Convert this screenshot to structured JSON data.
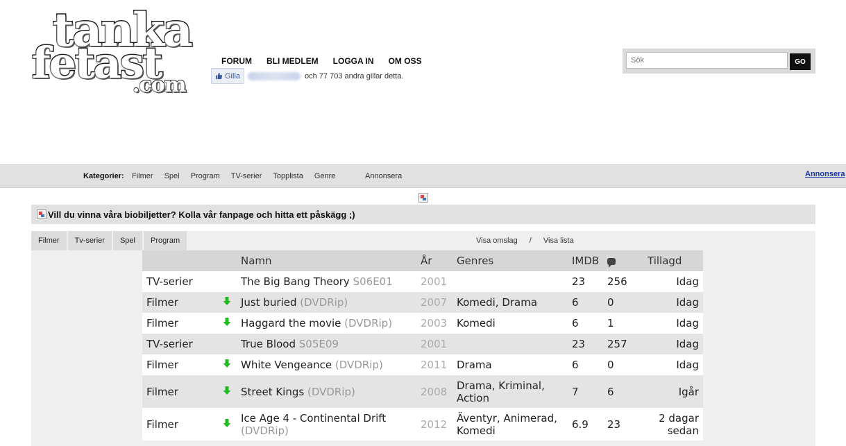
{
  "logo": {
    "line1": "tanka",
    "line2": "fetast",
    "line3": ".com"
  },
  "topnav": [
    "FORUM",
    "BLI MEDLEM",
    "LOGGA IN",
    "OM OSS"
  ],
  "like": {
    "button": "Gilla",
    "text": "och 77 703 andra gillar detta."
  },
  "search": {
    "placeholder": "Sök",
    "button": "GO"
  },
  "catbar": {
    "label": "Kategorier:",
    "items": [
      "Filmer",
      "Spel",
      "Program",
      "TV-serier",
      "Topplista",
      "Genre"
    ],
    "annonsera": "Annonsera",
    "annonsera_link": "Annonsera"
  },
  "banner": {
    "text": "Vill du vinna våra biobiljetter? Kolla vår fanpage och hitta ett påskägg ;)"
  },
  "tabs": [
    "Filmer",
    "Tv-serier",
    "Spel",
    "Program"
  ],
  "views": {
    "cover": "Visa omslag",
    "sep": "/",
    "list": "Visa lista"
  },
  "table": {
    "headers": {
      "name": "Namn",
      "year": "År",
      "genres": "Genres",
      "imdb": "IMDB",
      "added": "Tillagd"
    },
    "rows": [
      {
        "cat": "TV-serier",
        "dl": false,
        "name": "The Big Bang Theory",
        "tag": "S06E01",
        "year": "2001",
        "genres": "",
        "imdb": "23",
        "comments": "256",
        "added": "Idag"
      },
      {
        "cat": "Filmer",
        "dl": true,
        "name": "Just buried",
        "tag": "(DVDRip)",
        "year": "2007",
        "genres": "Komedi, Drama",
        "imdb": "6",
        "comments": "0",
        "added": "Idag"
      },
      {
        "cat": "Filmer",
        "dl": true,
        "name": "Haggard the movie",
        "tag": "(DVDRip)",
        "year": "2003",
        "genres": "Komedi",
        "imdb": "6",
        "comments": "1",
        "added": "Idag"
      },
      {
        "cat": "TV-serier",
        "dl": false,
        "name": "True Blood",
        "tag": "S05E09",
        "year": "2001",
        "genres": "",
        "imdb": "23",
        "comments": "257",
        "added": "Idag"
      },
      {
        "cat": "Filmer",
        "dl": true,
        "name": "White Vengeance",
        "tag": "(DVDRip)",
        "year": "2011",
        "genres": "Drama",
        "imdb": "6",
        "comments": "0",
        "added": "Idag"
      },
      {
        "cat": "Filmer",
        "dl": true,
        "name": "Street Kings",
        "tag": "(DVDRip)",
        "year": "2008",
        "genres": "Drama, Kriminal, Action",
        "imdb": "7",
        "comments": "6",
        "added": "Igår"
      },
      {
        "cat": "Filmer",
        "dl": true,
        "name": "Ice Age 4 - Continental Drift",
        "tag": "(DVDRip)",
        "year": "2012",
        "genres": "Äventyr, Animerad, Komedi",
        "imdb": "6.9",
        "comments": "23",
        "added": "2 dagar sedan"
      }
    ]
  },
  "colors": {
    "download_arrow": "#22bb22",
    "link_blue": "#1a37a8",
    "bar_gray": "#e1e1e1"
  }
}
